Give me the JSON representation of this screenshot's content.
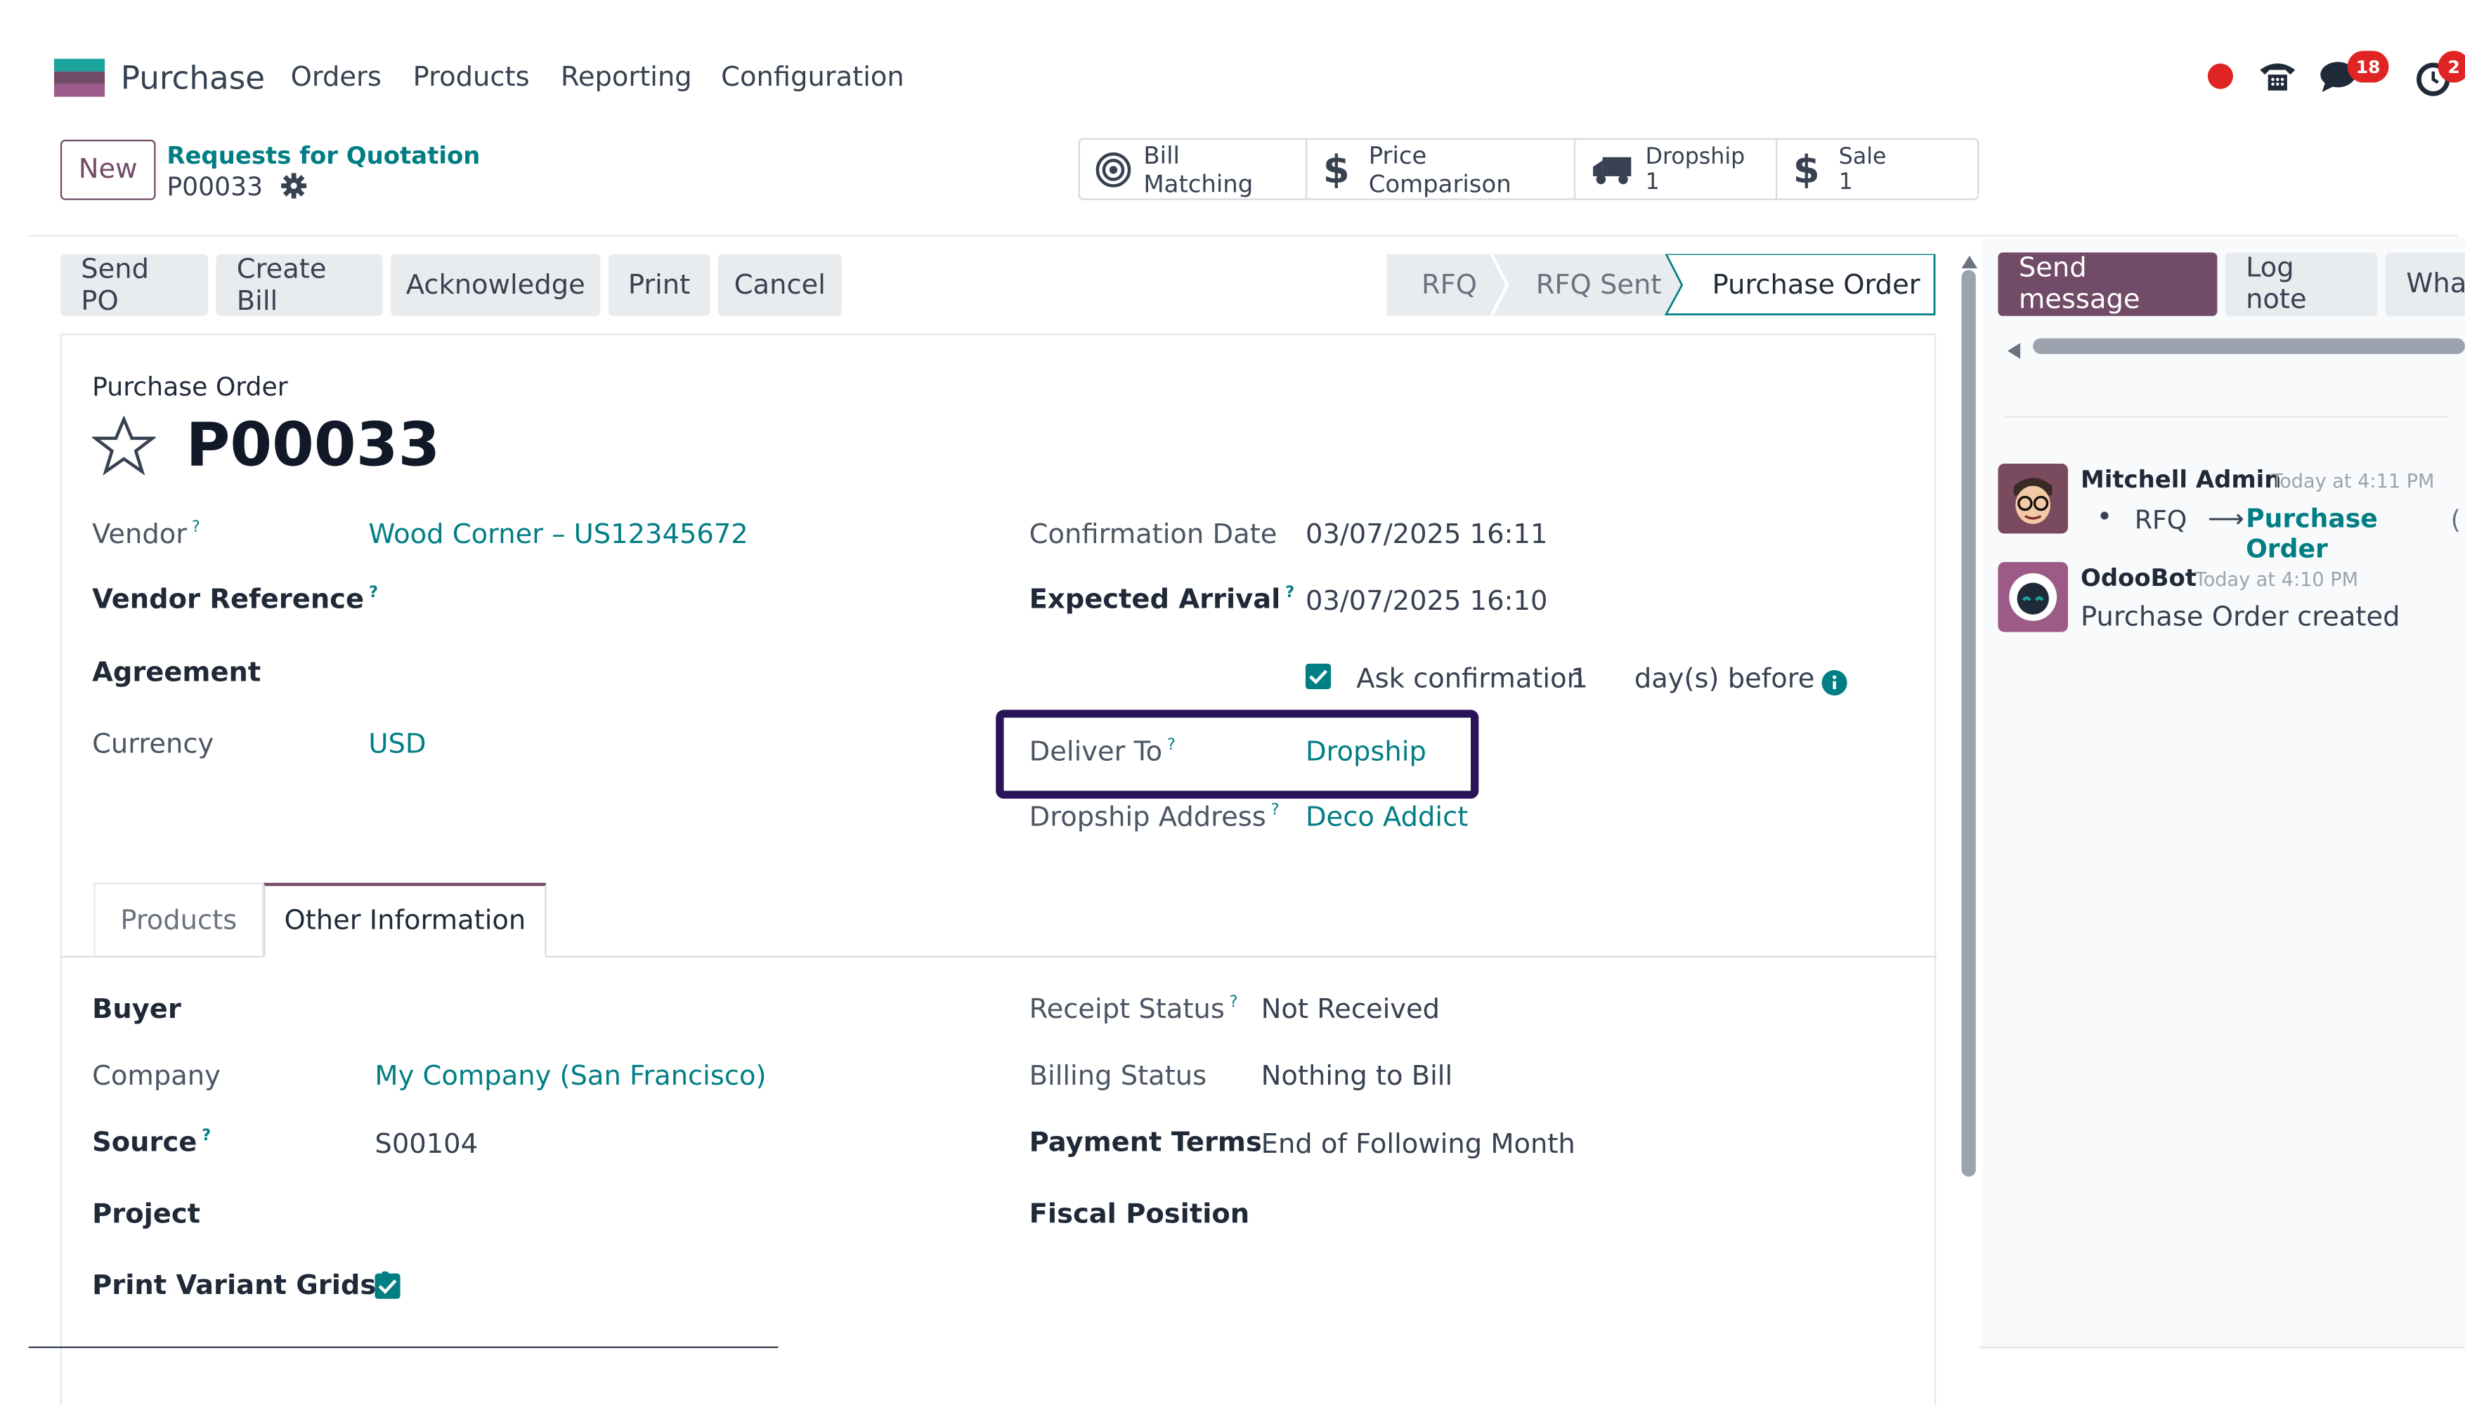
{
  "nav": {
    "app_name": "Purchase",
    "items": [
      "Orders",
      "Products",
      "Reporting",
      "Configuration"
    ],
    "notif_count_chat": "18",
    "notif_count_activity": "2"
  },
  "breadcrumb": {
    "new_label": "New",
    "parent": "Requests for Quotation",
    "current": "P00033"
  },
  "smart_buttons": {
    "bill_matching": "Bill Matching",
    "price_comparison": "Price Comparison",
    "dropship_label": "Dropship",
    "dropship_count": "1",
    "sale_label": "Sale",
    "sale_count": "1"
  },
  "actions": {
    "send_po": "Send PO",
    "create_bill": "Create Bill",
    "acknowledge": "Acknowledge",
    "print": "Print",
    "cancel": "Cancel"
  },
  "statusbar": {
    "rfq": "RFQ",
    "rfq_sent": "RFQ Sent",
    "purchase_order": "Purchase Order"
  },
  "form": {
    "record_type": "Purchase Order",
    "name": "P00033",
    "vendor_label": "Vendor",
    "vendor_value": "Wood Corner – US12345672",
    "vendor_ref_label": "Vendor Reference",
    "agreement_label": "Agreement",
    "currency_label": "Currency",
    "currency_value": "USD",
    "confirmation_date_label": "Confirmation Date",
    "confirmation_date_value": "03/07/2025 16:11",
    "expected_arrival_label": "Expected Arrival",
    "expected_arrival_value": "03/07/2025 16:10",
    "ask_confirmation_label": "Ask confirmation",
    "ask_confirmation_days": "1",
    "ask_confirmation_suffix": "day(s) before",
    "deliver_to_label": "Deliver To",
    "deliver_to_value": "Dropship",
    "dropship_address_label": "Dropship Address",
    "dropship_address_value": "Deco Addict",
    "help_mark": "?"
  },
  "tabs": {
    "products": "Products",
    "other_info": "Other Information"
  },
  "other_info": {
    "buyer_label": "Buyer",
    "company_label": "Company",
    "company_value": "My Company (San Francisco)",
    "source_label": "Source",
    "source_value": "S00104",
    "project_label": "Project",
    "print_variant_label": "Print Variant Grids",
    "receipt_status_label": "Receipt Status",
    "receipt_status_value": "Not Received",
    "billing_status_label": "Billing Status",
    "billing_status_value": "Nothing to Bill",
    "payment_terms_label": "Payment Terms",
    "payment_terms_value": "End of Following Month",
    "fiscal_position_label": "Fiscal Position"
  },
  "chatter": {
    "send_message": "Send message",
    "log_note": "Log note",
    "whatsapp": "Wha",
    "msg1_author": "Mitchell Admin",
    "msg1_time": "Today at 4:11 PM",
    "msg1_from": "RFQ",
    "msg1_arrow": "⟶",
    "msg1_to": "Purchase Order",
    "msg1_paren": "(",
    "msg2_author": "OdooBot",
    "msg2_time": "Today at 4:10 PM",
    "msg2_body": "Purchase Order created"
  },
  "colors": {
    "brand": "#714b67",
    "link": "#017e84",
    "highlight_box": "#2a1458"
  }
}
